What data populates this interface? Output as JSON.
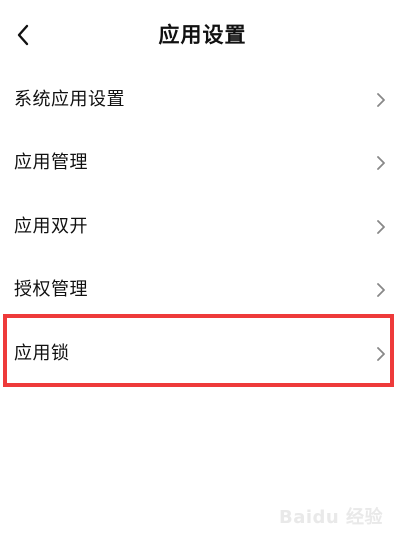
{
  "header": {
    "title": "应用设置",
    "back_icon": "chevron-left-icon"
  },
  "menu": {
    "items": [
      {
        "label": "系统应用设置",
        "icon": "chevron-right-icon"
      },
      {
        "label": "应用管理",
        "icon": "chevron-right-icon"
      },
      {
        "label": "应用双开",
        "icon": "chevron-right-icon"
      },
      {
        "label": "授权管理",
        "icon": "chevron-right-icon"
      },
      {
        "label": "应用锁",
        "icon": "chevron-right-icon",
        "highlighted": true
      }
    ]
  },
  "annotation": {
    "highlight_color": "#ee3a3a"
  },
  "watermark": {
    "text": "Baidu 经验"
  }
}
